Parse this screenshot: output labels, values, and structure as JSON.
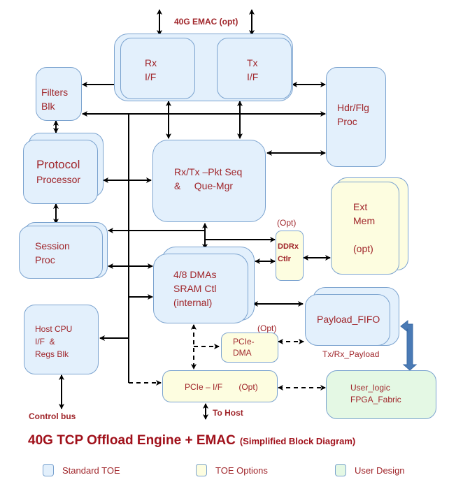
{
  "diagram": {
    "top_label": "40G EMAC (opt)",
    "blocks": {
      "rx_if": "Rx\nI/F",
      "tx_if": "Tx\nI/F",
      "filters": "Filters\nBlk",
      "hdr_flg": "Hdr/Flg\nProc",
      "protocol_line1": "Protocol",
      "protocol_line2": "Processor",
      "pkt_seq": "Rx/Tx –Pkt Seq\n&     Que-Mgr",
      "ext_mem": "Ext\nMem\n\n(opt)",
      "session": "Session\nProc",
      "ddr_opt": "(Opt)",
      "ddr_ctlr": "DDRx\nCtlr",
      "dmas": "4/8 DMAs\nSRAM Ctl\n(internal)",
      "host_cpu": "Host CPU\nI/F  &\nRegs Blk",
      "payload_fifo": "Payload_FIFO",
      "payload_caption": "Tx/Rx_Payload",
      "pcie_dma_opt": "(Opt)",
      "pcie_dma": "PCIe-\nDMA",
      "pcie_if": "PCIe – I/F       (Opt)",
      "user_logic": "User_logic\nFPGA_Fabric"
    },
    "control_bus": "Control bus",
    "to_host": "To Host"
  },
  "title": {
    "main": "40G TCP Offload Engine + EMAC",
    "sub": "(Simplified Block Diagram)"
  },
  "legend": [
    {
      "label": "Standard TOE",
      "color": "#e3f0fc"
    },
    {
      "label": "TOE Options",
      "color": "#fdfde0"
    },
    {
      "label": "User Design",
      "color": "#e4f8e4"
    }
  ],
  "colors": {
    "text": "#a0262b",
    "border": "#7ba3cf",
    "standard": "#e3f0fc",
    "option": "#fdfde0",
    "user": "#e4f8e4",
    "fat_arrow": "#4a7ab5"
  }
}
